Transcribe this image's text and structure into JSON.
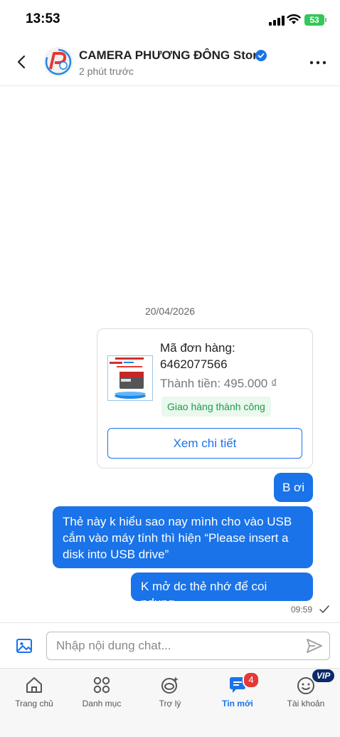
{
  "status_bar": {
    "time": "13:53",
    "battery": "53"
  },
  "header": {
    "store_name": "CAMERA PHƯƠNG ĐÔNG Store",
    "last_seen": "2 phút trước"
  },
  "conversation": {
    "date": "20/04/2026",
    "order": {
      "code_label": "Mã đơn hàng:",
      "code": "6462077566",
      "total": "Thành tiền: 495.000 ₫",
      "status": "Giao hàng thành công",
      "detail_button": "Xem chi tiết"
    },
    "messages": [
      {
        "text": "B ơi"
      },
      {
        "text": "Thẻ này k hiểu sao nay mình cho vào USB cắm vào máy tính thì hiện “Please insert a disk into USB drive”"
      },
      {
        "text": "K mở dc thẻ nhớ để coi ndung"
      }
    ],
    "time": "09:59"
  },
  "composer": {
    "placeholder": "Nhập nội dung chat..."
  },
  "tabbar": {
    "tabs": [
      {
        "label": "Trang chủ",
        "icon": "home-icon"
      },
      {
        "label": "Danh mục",
        "icon": "grid-icon"
      },
      {
        "label": "Trợ lý",
        "icon": "assistant-icon"
      },
      {
        "label": "Tin mới",
        "icon": "chat-icon",
        "badge": "4",
        "active": true
      },
      {
        "label": "Tài khoản",
        "icon": "account-icon",
        "vip": "VIP"
      }
    ]
  },
  "colors": {
    "accent": "#1a73e8",
    "success": "#1a9c48",
    "badge": "#e53935",
    "vip": "#0b2a6b"
  }
}
